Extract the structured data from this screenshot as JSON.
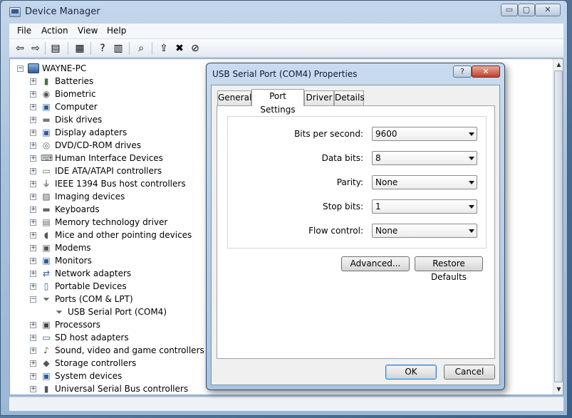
{
  "window": {
    "title": "Device Manager",
    "controls": {
      "minimize": "▭",
      "maximize": "▢",
      "close": "✕"
    }
  },
  "menu": {
    "file": "File",
    "action": "Action",
    "view": "View",
    "help": "Help"
  },
  "toolbar": {
    "buttons": [
      {
        "name": "back-icon",
        "glyph": "⇦"
      },
      {
        "name": "forward-icon",
        "glyph": "⇨"
      },
      {
        "name": "show-hide-console-tree-icon",
        "glyph": "▤"
      },
      {
        "name": "properties-icon",
        "glyph": "▦"
      },
      {
        "name": "help-icon",
        "glyph": "?"
      },
      {
        "name": "console-view-icon",
        "glyph": "▥"
      },
      {
        "name": "scan-hardware-icon",
        "glyph": "⌕"
      },
      {
        "name": "update-driver-icon",
        "glyph": "⇪"
      },
      {
        "name": "uninstall-icon",
        "glyph": "✖"
      },
      {
        "name": "disable-icon",
        "glyph": "⊘"
      }
    ]
  },
  "tree": {
    "root": {
      "label": "WAYNE-PC",
      "icon": "computer-icon",
      "expander": "−"
    },
    "categories": [
      {
        "label": "Batteries",
        "icon": "battery-icon",
        "expander": "+",
        "glyph": "▮",
        "color": "#3a7d3a"
      },
      {
        "label": "Biometric",
        "icon": "fingerprint-icon",
        "expander": "+",
        "glyph": "◉",
        "color": "#555555"
      },
      {
        "label": "Computer",
        "icon": "computer-icon",
        "expander": "+",
        "glyph": "▣",
        "color": "#2d5c9c"
      },
      {
        "label": "Disk drives",
        "icon": "disk-drive-icon",
        "expander": "+",
        "glyph": "▬",
        "color": "#777777"
      },
      {
        "label": "Display adapters",
        "icon": "display-adapter-icon",
        "expander": "+",
        "glyph": "▣",
        "color": "#2d5c9c"
      },
      {
        "label": "DVD/CD-ROM drives",
        "icon": "dvd-drive-icon",
        "expander": "+",
        "glyph": "◎",
        "color": "#666666"
      },
      {
        "label": "Human Interface Devices",
        "icon": "hid-icon",
        "expander": "+",
        "glyph": "⌨",
        "color": "#555555"
      },
      {
        "label": "IDE ATA/ATAPI controllers",
        "icon": "ide-controller-icon",
        "expander": "+",
        "glyph": "▭",
        "color": "#4a7a4a"
      },
      {
        "label": "IEEE 1394 Bus host controllers",
        "icon": "firewire-icon",
        "expander": "+",
        "glyph": "⏚",
        "color": "#333333"
      },
      {
        "label": "Imaging devices",
        "icon": "camera-icon",
        "expander": "+",
        "glyph": "▨",
        "color": "#555555"
      },
      {
        "label": "Keyboards",
        "icon": "keyboard-icon",
        "expander": "+",
        "glyph": "▬",
        "color": "#666666"
      },
      {
        "label": "Memory technology driver",
        "icon": "memory-icon",
        "expander": "+",
        "glyph": "▤",
        "color": "#666666"
      },
      {
        "label": "Mice and other pointing devices",
        "icon": "mouse-icon",
        "expander": "+",
        "glyph": "◖",
        "color": "#555555"
      },
      {
        "label": "Modems",
        "icon": "modem-icon",
        "expander": "+",
        "glyph": "▣",
        "color": "#555555"
      },
      {
        "label": "Monitors",
        "icon": "monitor-icon",
        "expander": "+",
        "glyph": "▣",
        "color": "#2d5c9c"
      },
      {
        "label": "Network adapters",
        "icon": "network-adapter-icon",
        "expander": "+",
        "glyph": "⇄",
        "color": "#2d5c9c"
      },
      {
        "label": "Portable Devices",
        "icon": "portable-device-icon",
        "expander": "+",
        "glyph": "▯",
        "color": "#2d5c9c"
      },
      {
        "label": "Ports (COM & LPT)",
        "icon": "port-icon",
        "expander": "−",
        "glyph": "⏷",
        "color": "#666666"
      },
      {
        "label": "USB Serial Port (COM4)",
        "icon": "serial-port-icon",
        "expander": "",
        "glyph": "⏷",
        "color": "#666666",
        "child": true
      },
      {
        "label": "Processors",
        "icon": "processor-icon",
        "expander": "+",
        "glyph": "▣",
        "color": "#444444"
      },
      {
        "label": "SD host adapters",
        "icon": "sd-adapter-icon",
        "expander": "+",
        "glyph": "▭",
        "color": "#2d5c9c"
      },
      {
        "label": "Sound, video and game controllers",
        "icon": "speaker-icon",
        "expander": "+",
        "glyph": "♪",
        "color": "#555555"
      },
      {
        "label": "Storage controllers",
        "icon": "storage-controller-icon",
        "expander": "+",
        "glyph": "◆",
        "color": "#555555"
      },
      {
        "label": "System devices",
        "icon": "system-device-icon",
        "expander": "+",
        "glyph": "▣",
        "color": "#2d5c9c"
      },
      {
        "label": "Universal Serial Bus controllers",
        "icon": "usb-icon",
        "expander": "+",
        "glyph": "▮",
        "color": "#555555"
      }
    ]
  },
  "dialog": {
    "title": "USB Serial Port (COM4) Properties",
    "help_button": "?",
    "close_button": "✕",
    "tabs": {
      "general": "General",
      "port_settings": "Port Settings",
      "driver": "Driver",
      "details": "Details"
    },
    "active_tab": "Port Settings",
    "fields": {
      "bits_per_second": {
        "label": "Bits per second:",
        "value": "9600"
      },
      "data_bits": {
        "label": "Data bits:",
        "value": "8"
      },
      "parity": {
        "label": "Parity:",
        "value": "None"
      },
      "stop_bits": {
        "label": "Stop bits:",
        "value": "1"
      },
      "flow_control": {
        "label": "Flow control:",
        "value": "None"
      }
    },
    "buttons": {
      "advanced": "Advanced...",
      "restore_defaults": "Restore Defaults",
      "ok": "OK",
      "cancel": "Cancel"
    }
  }
}
